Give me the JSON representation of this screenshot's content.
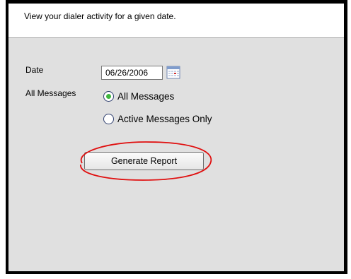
{
  "header": {
    "description": "View your dialer activity for a given date."
  },
  "form": {
    "date_label": "Date",
    "date_value": "06/26/2006",
    "messages_label": "All Messages",
    "radio_options": [
      {
        "label": "All Messages",
        "checked": true
      },
      {
        "label": "Active Messages Only",
        "checked": false
      }
    ],
    "generate_label": "Generate Report"
  },
  "colors": {
    "panel_bg": "#e0e0e0",
    "radio_selected": "#3fb73f",
    "highlight_ellipse": "#e01010"
  },
  "icons": {
    "calendar": "calendar-icon"
  }
}
